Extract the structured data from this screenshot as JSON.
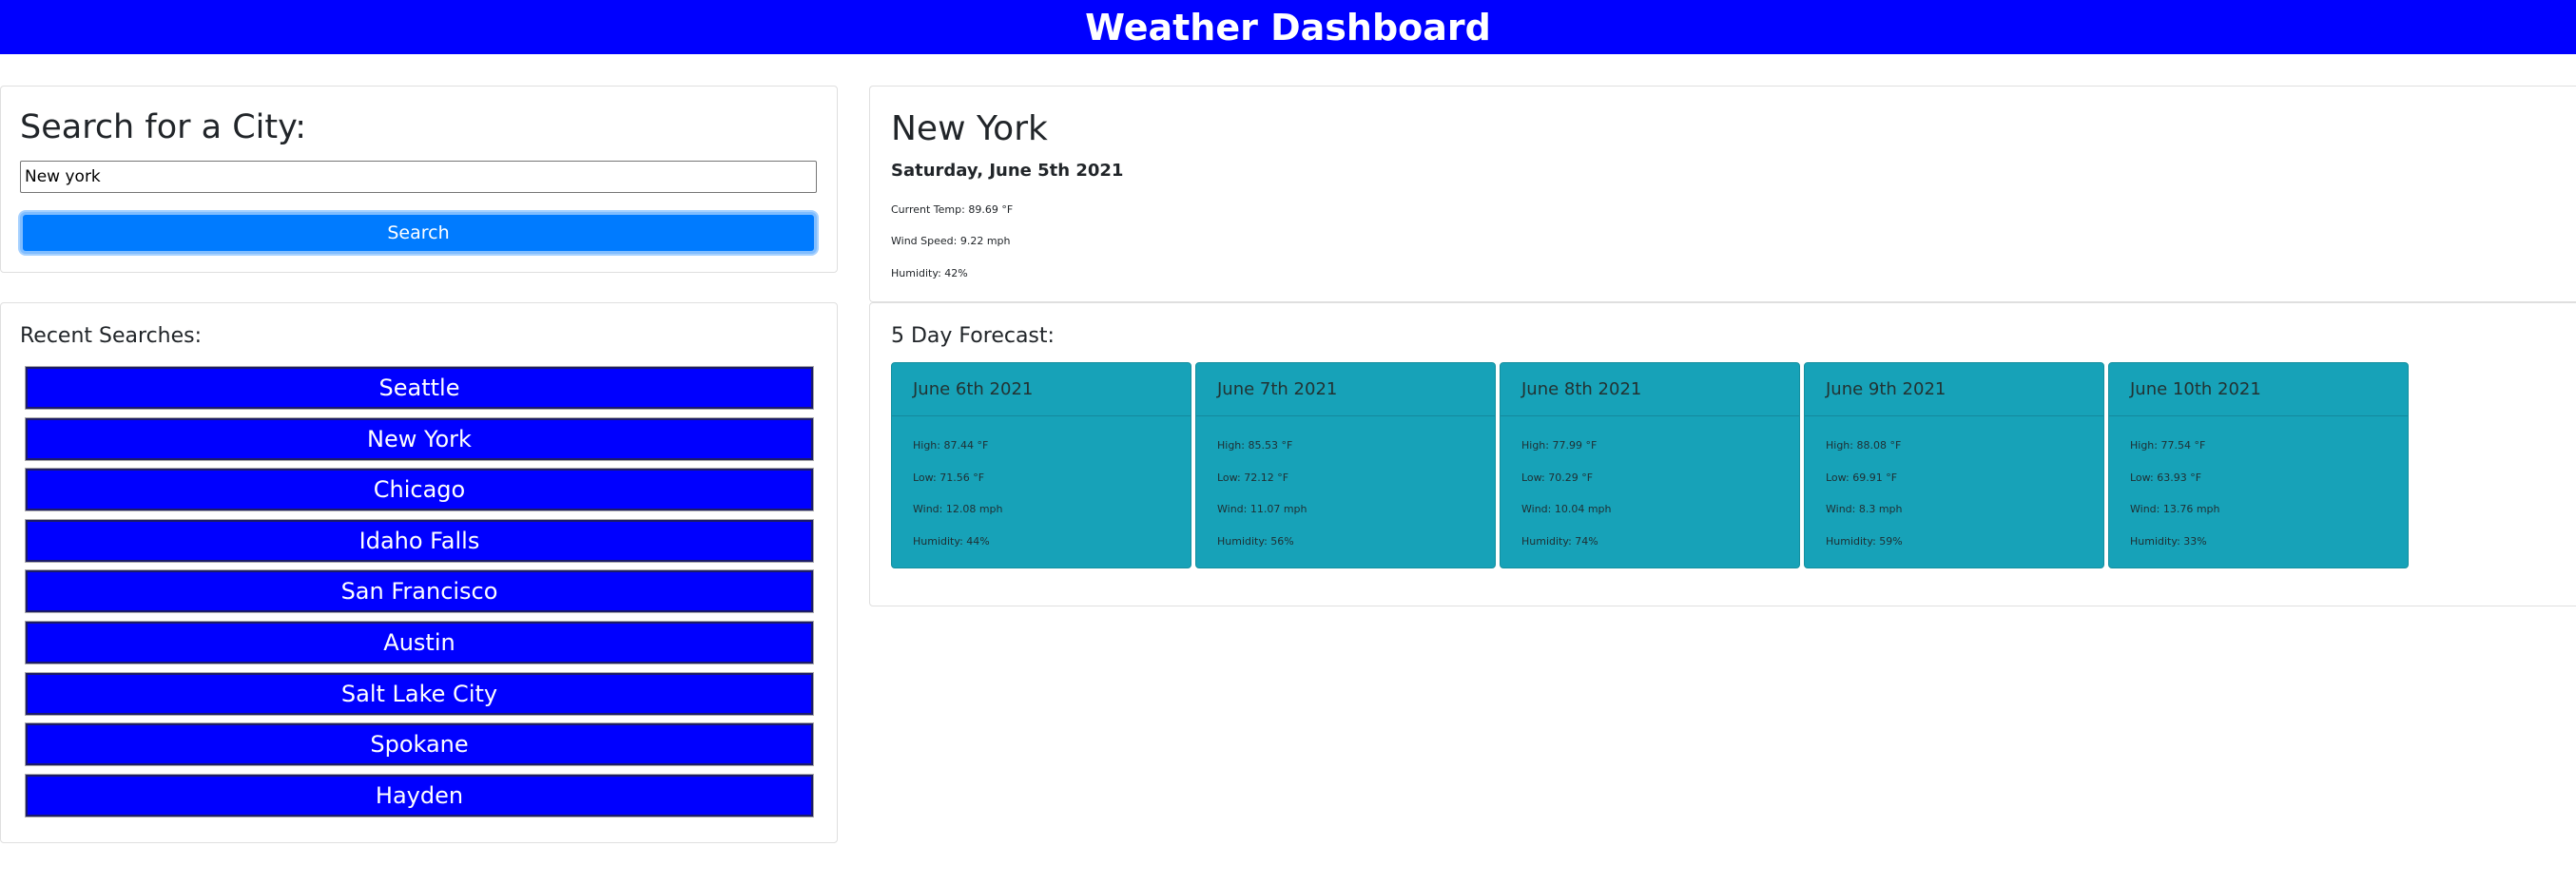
{
  "header": {
    "title": "Weather Dashboard"
  },
  "search": {
    "title": "Search for a City:",
    "input_value": "New york",
    "button_label": "Search"
  },
  "recent": {
    "title": "Recent Searches:",
    "items": [
      "Seattle",
      "New York",
      "Chicago",
      "Idaho Falls",
      "San Francisco",
      "Austin",
      "Salt Lake City",
      "Spokane",
      "Hayden"
    ]
  },
  "current": {
    "city": "New York",
    "date": "Saturday, June 5th 2021",
    "temp": "Current Temp: 89.69 °F",
    "wind": "Wind Speed: 9.22 mph",
    "humidity": "Humidity: 42%"
  },
  "forecast": {
    "title": "5 Day Forecast:",
    "days": [
      {
        "date": "June 6th 2021",
        "high": "High: 87.44 °F",
        "low": "Low: 71.56 °F",
        "wind": "Wind: 12.08 mph",
        "humidity": "Humidity: 44%"
      },
      {
        "date": "June 7th 2021",
        "high": "High: 85.53 °F",
        "low": "Low: 72.12 °F",
        "wind": "Wind: 11.07 mph",
        "humidity": "Humidity: 56%"
      },
      {
        "date": "June 8th 2021",
        "high": "High: 77.99 °F",
        "low": "Low: 70.29 °F",
        "wind": "Wind: 10.04 mph",
        "humidity": "Humidity: 74%"
      },
      {
        "date": "June 9th 2021",
        "high": "High: 88.08 °F",
        "low": "Low: 69.91 °F",
        "wind": "Wind: 8.3 mph",
        "humidity": "Humidity: 59%"
      },
      {
        "date": "June 10th 2021",
        "high": "High: 77.54 °F",
        "low": "Low: 63.93 °F",
        "wind": "Wind: 13.76 mph",
        "humidity": "Humidity: 33%"
      }
    ]
  },
  "colors": {
    "header_bg": "#0000ff",
    "search_button": "#007bff",
    "recent_item_bg": "#0000ff",
    "forecast_card_bg": "#17a2b8"
  }
}
